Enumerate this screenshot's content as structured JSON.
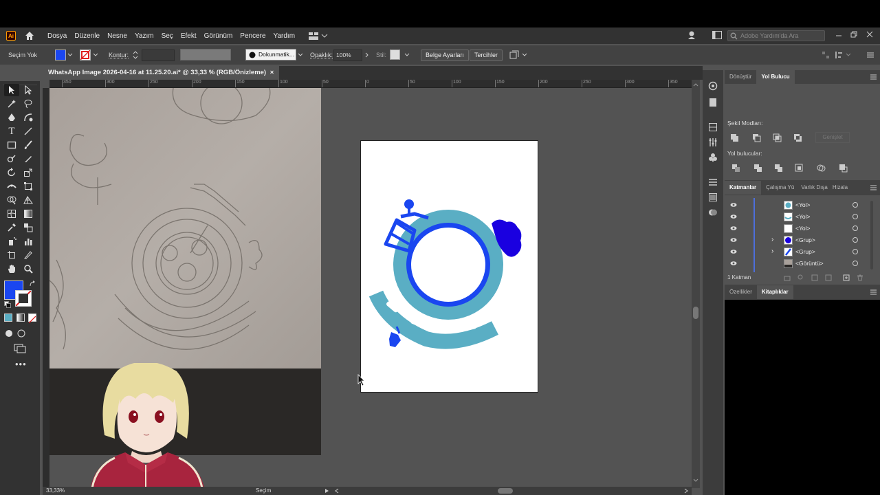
{
  "menubar": {
    "app_logo": "Ai",
    "items": [
      "Dosya",
      "Düzenle",
      "Nesne",
      "Yazım",
      "Seç",
      "Efekt",
      "Görünüm",
      "Pencere",
      "Yardım"
    ],
    "search_placeholder": "Adobe Yardım'da Ara"
  },
  "control": {
    "selection": "Seçim Yok",
    "stroke_label": "Kontur:",
    "brush": "Dokunmatik...",
    "opacity_label": "Opaklık:",
    "opacity_value": "100%",
    "style_label": "Stil:",
    "doc_settings": "Belge Ayarları",
    "prefs": "Tercihler",
    "fill_color": "#1a46f0"
  },
  "tab": {
    "title": "WhatsApp Image 2026-04-16 at 11.25.20.ai* @ 33,33 % (RGB/Önizleme)",
    "close": "×"
  },
  "ruler": {
    "h_labels": [
      "350",
      "300",
      "250",
      "200",
      "150",
      "100",
      "50",
      "0",
      "50",
      "100",
      "150",
      "200",
      "250",
      "300",
      "350"
    ]
  },
  "status": {
    "zoom": "33,33%",
    "tool": "Seçim"
  },
  "pathfinder": {
    "tabs": [
      "Dönüştür",
      "Yol Bulucu"
    ],
    "modes_label": "Şekil Modları:",
    "expand": "Genişlet",
    "finders_label": "Yol bulucular:"
  },
  "layers": {
    "tabs": [
      "Katmanlar",
      "Çalışma Yü",
      "Varlık Dışa",
      "Hizala"
    ],
    "rows": [
      {
        "name": "<Yol>",
        "expand": ""
      },
      {
        "name": "<Yol>",
        "expand": ""
      },
      {
        "name": "<Yol>",
        "expand": ""
      },
      {
        "name": "<Grup>",
        "expand": "›"
      },
      {
        "name": "<Grup>",
        "expand": "›"
      },
      {
        "name": "<Görüntü>",
        "expand": ""
      }
    ],
    "count": "1 Katman"
  },
  "bottom_panel": {
    "tabs": [
      "Özellikler",
      "Kitaplıklar"
    ]
  },
  "colors": {
    "teal": "#5aaec4",
    "blue": "#1a46f0",
    "dark_blue": "#1a00e0",
    "ui_dark": "#323232"
  }
}
